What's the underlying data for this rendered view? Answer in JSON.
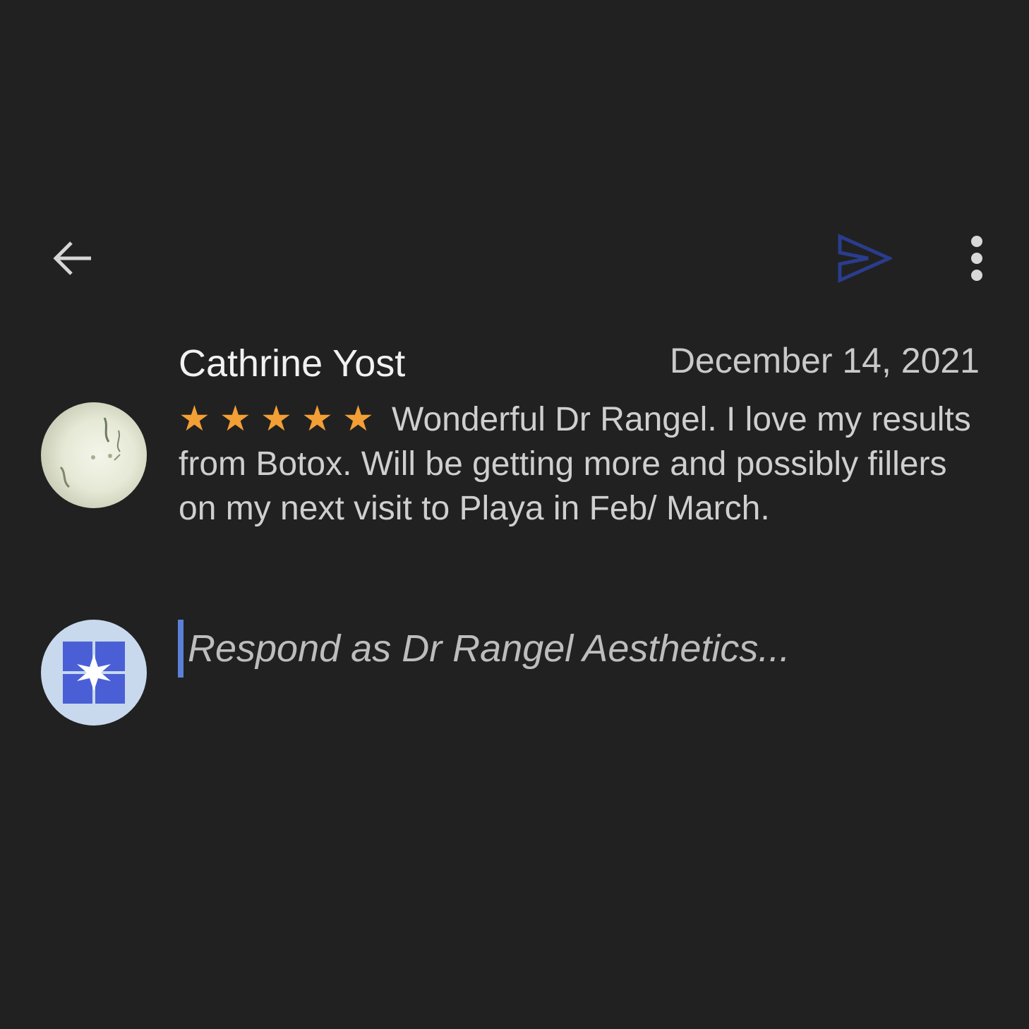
{
  "toolbar": {
    "back_icon": "arrow-left-icon",
    "send_icon": "send-icon",
    "send_color": "#2a3c8c",
    "more_icon": "more-vert-icon"
  },
  "review": {
    "reviewer_name": "Cathrine Yost",
    "date": "December 14, 2021",
    "rating": 5,
    "rating_max": 5,
    "star_color": "#f29f36",
    "stars": [
      "★",
      "★",
      "★",
      "★",
      "★"
    ],
    "text": "Wonderful Dr Rangel. I love my results from Botox. Will be getting more and possibly fillers on my next visit to Playa in Feb/ March."
  },
  "response": {
    "placeholder": "Respond as Dr Rangel Aesthetics...",
    "value": "",
    "avatar_bg": "#c8d9ee",
    "avatar_accent": "#4a5fd6"
  }
}
